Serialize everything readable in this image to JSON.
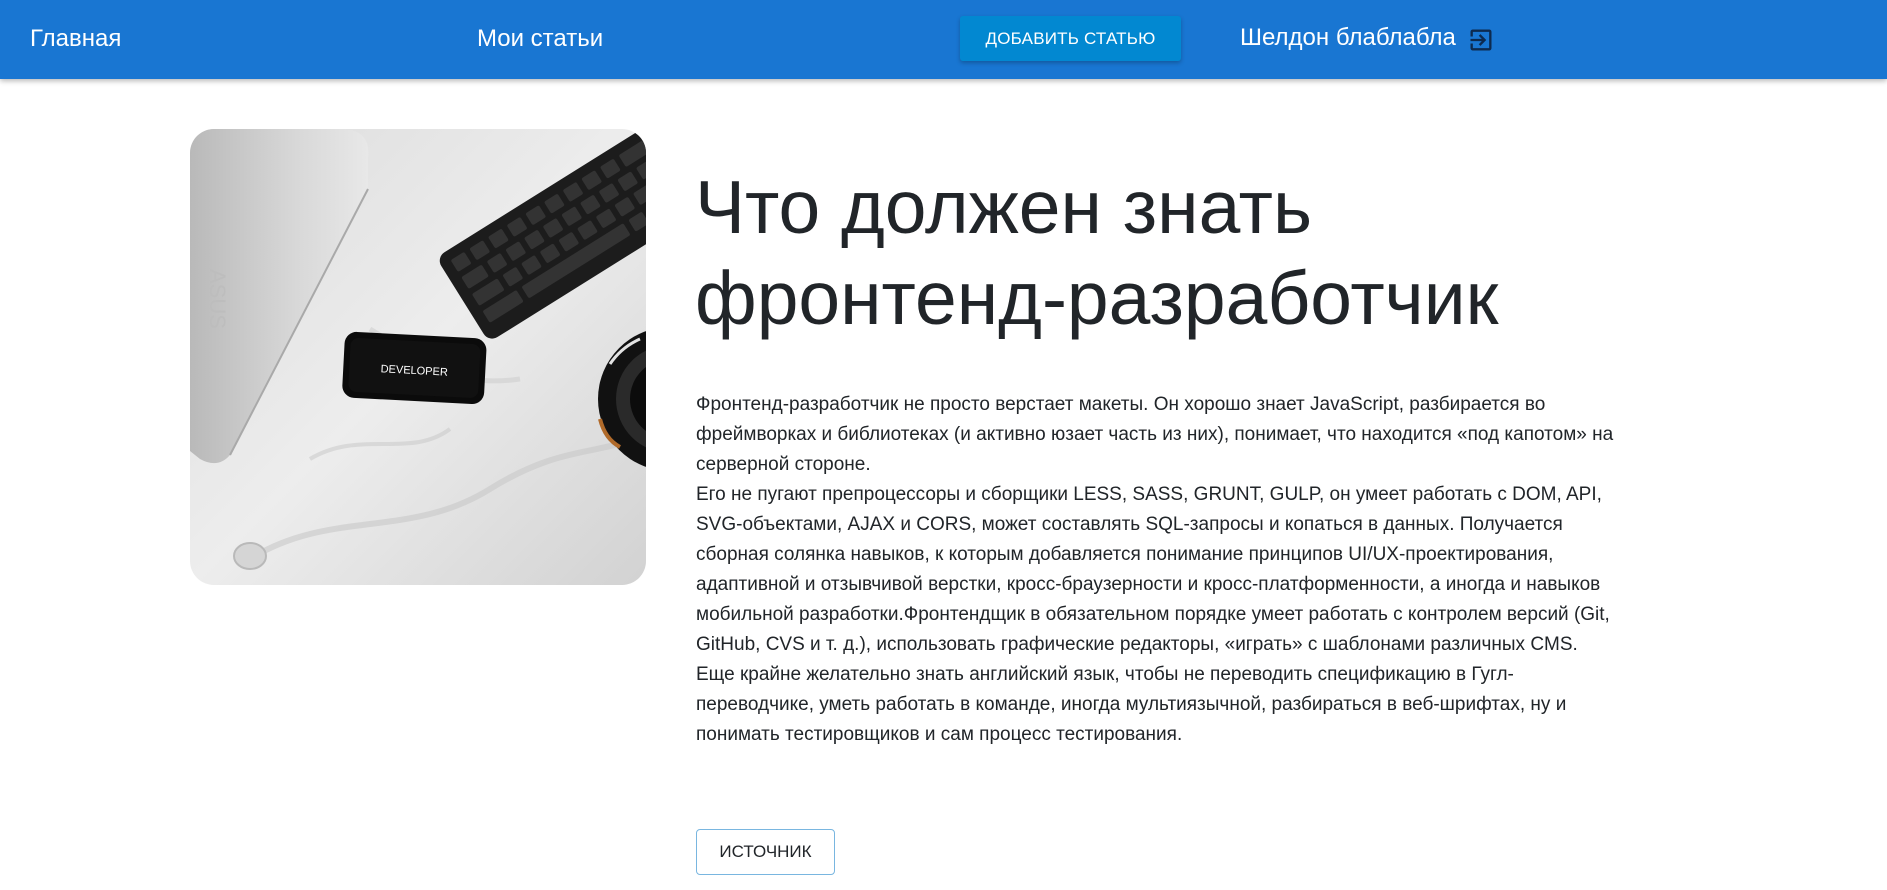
{
  "nav": {
    "home_label": "Главная",
    "my_articles_label": "Мои статьи",
    "add_article_label": "ДОБАВИТЬ СТАТЬЮ",
    "user_name": "Шелдон блаблабла",
    "logout_icon": "logout-icon"
  },
  "article": {
    "image_icon": "desk-photo",
    "image_phone_text": "DEVELOPER",
    "image_laptop_text": "ASUS",
    "title": "Что должен знать фронтенд-разработчик",
    "paragraph_1": "Фронтенд-разработчик не просто верстает макеты. Он хорошо знает JavaScript, разбирается во фреймворках и библиотеках (и активно юзает часть из них), понимает, что находится «под капотом» на серверной стороне.",
    "paragraph_2": "Его не пугают препроцессоры и сборщики LESS, SASS, GRUNT, GULP, он умеет работать с DOM, API, SVG-объектами, AJAX и CORS, может составлять SQL-запросы и копаться в данных. Получается сборная солянка навыков, к которым добавляется понимание принципов UI/UX-проектирования, адаптивной и отзывчивой верстки, кросс-браузерности и кросс-платформенности, а иногда и навыков мобильной разработки.Фронтендщик в обязательном порядке умеет работать с контролем версий (Git, GitHub, CVS и т. д.), использовать графические редакторы, «играть» с шаблонами различных CMS. Еще крайне желательно знать английский язык, чтобы не переводить спецификацию в Гугл-переводчике, уметь работать в команде, иногда мультиязычной, разбираться в веб-шрифтах, ну и понимать тестировщиков и сам процесс тестирования.",
    "source_label": "ИСТОЧНИК"
  },
  "colors": {
    "navbar": "#1976d2",
    "add_button": "#0288d1",
    "text": "#212529",
    "source_border": "#79b6e0"
  }
}
